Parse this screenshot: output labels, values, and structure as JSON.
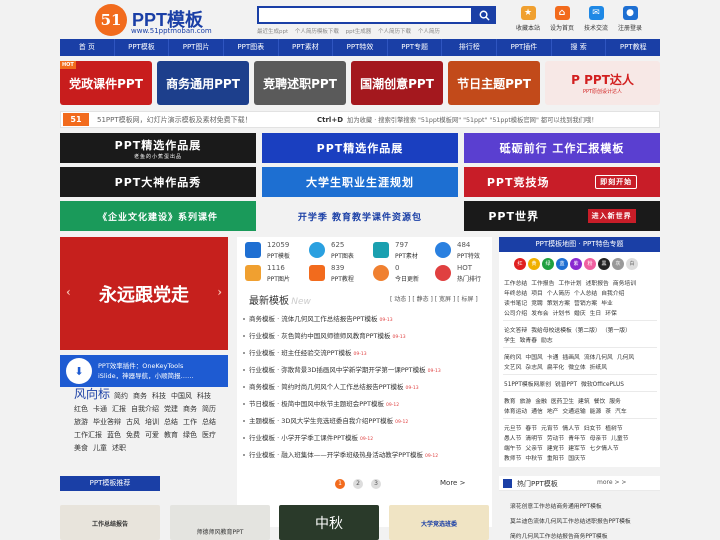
{
  "header": {
    "logo_mark": "51",
    "site_name": "PPT模板",
    "domain": "www.51pptmoban.com",
    "search_placeholder": "",
    "hot_links": [
      "最近生成ppt",
      "个人简历模板下载",
      "ppt生成器",
      "个人简历下载",
      "个人简历"
    ],
    "tools": [
      {
        "label": "收藏本站",
        "icon": "bookmark-icon",
        "color": "#f0a030"
      },
      {
        "label": "设为首页",
        "icon": "home-icon",
        "color": "#f26b1d"
      },
      {
        "label": "技术交流",
        "icon": "chat-icon",
        "color": "#1e88e5"
      },
      {
        "label": "注册登录",
        "icon": "user-icon",
        "color": "#1e6fd2"
      }
    ]
  },
  "nav": [
    "首 页",
    "PPT模板",
    "PPT图片",
    "PPT图表",
    "PPT素材",
    "PPT特效",
    "PPT专题",
    "排行榜",
    "PPT插件",
    "搜 索",
    "PPT教程"
  ],
  "categories": [
    {
      "label": "党政课件PPT",
      "color": "#c81d1d",
      "badge": "HOT"
    },
    {
      "label": "商务通用PPT",
      "color": "#1d3f8c"
    },
    {
      "label": "竞聘述职PPT",
      "color": "#5a5a5a"
    },
    {
      "label": "国潮创意PPT",
      "color": "#a4181e"
    },
    {
      "label": "节日主题PPT",
      "color": "#c24a1a"
    },
    {
      "label": "P PPT达人",
      "color": "#f7e8e6",
      "sub": "PPT原创设计达人"
    }
  ],
  "notice": {
    "badge": "51",
    "text": "51PPT模板网，幻灯片演示模板及素材免费下载！",
    "shortcut": "Ctrl+D",
    "tip": "加为收藏 · 搜索引擎搜索 \"51ppt模板网\" \"51ppt\" \"51ppt模板官网\" 都可以找到我们哦！"
  },
  "ads": [
    {
      "label": "PPT精选作品展",
      "sub": "老鱼的小蕉蛋出品",
      "color": "#1a1a1a"
    },
    {
      "label": "PPT精选作品展",
      "color": "#1a3fc0"
    },
    {
      "label": "砥砺前行 工作汇报模板",
      "color": "#5a3fd0"
    },
    {
      "label": "PPT大神作品秀",
      "color": "#1a1a1a"
    },
    {
      "label": "大学生职业生涯规划",
      "color": "#1d6fd2"
    },
    {
      "label": "PPT竞技场",
      "sub": "即刻开始",
      "color": "#c81d28"
    },
    {
      "label": "《企业文化建设》系列课件",
      "color": "#1a9a5a"
    },
    {
      "label": "开学季 教育教学课件资源包",
      "color": "#f2f2f2"
    },
    {
      "label": "PPT世界",
      "sub": "进入新世界",
      "color": "#1a1a1a"
    }
  ],
  "slider": {
    "text": "永远跟党走"
  },
  "tool_card": {
    "title": "PPT效率插件：OneKeyTools",
    "desc": "iSlide，神器导航，小顺简报……"
  },
  "tags": {
    "title": "风向标",
    "items": [
      "简约",
      "商务",
      "科技",
      "中国风",
      "科技",
      "红色",
      "卡通",
      "汇报",
      "自我介绍",
      "党建",
      "商务",
      "简历",
      "旅游",
      "毕业答辩",
      "古风",
      "培训",
      "总结",
      "工作",
      "总结",
      "工作汇报",
      "蓝色",
      "免费",
      "可爱",
      "教育",
      "绿色",
      "医疗",
      "美食",
      "儿童",
      "述职"
    ]
  },
  "stats": [
    {
      "num": "12059",
      "label": "PPT模板",
      "color": "#1e6fd2"
    },
    {
      "num": "625",
      "label": "PPT图表",
      "color": "#2aa0e0"
    },
    {
      "num": "797",
      "label": "PPT素材",
      "color": "#1aa0b0"
    },
    {
      "num": "484",
      "label": "PPT特效",
      "color": "#2a80e0"
    },
    {
      "num": "1116",
      "label": "PPT图片",
      "color": "#f0a030"
    },
    {
      "num": "839",
      "label": "PPT教程",
      "color": "#f26b1d"
    },
    {
      "num": "0",
      "label": "今日更新",
      "color": "#f08030"
    },
    {
      "num": "HOT",
      "label": "热门排行",
      "color": "#e04040"
    }
  ],
  "latest": {
    "title": "最新模板",
    "en": "New",
    "filters": "[ 动态 ] [ 静态 ] [ 宽屏 ] [ 标屏 ]",
    "items": [
      {
        "cat": "商务模板",
        "title": "流体几何风工作总结报告PPT模板",
        "date": "09-13"
      },
      {
        "cat": "行业模板",
        "title": "灰色简约中国风师德师风教育PPT模板",
        "date": "09-13"
      },
      {
        "cat": "行业模板",
        "title": "班主任经验交流PPT模板",
        "date": "09-13"
      },
      {
        "cat": "行业模板",
        "title": "弥散背景3D插画风中学新学期开学第一课PPT模板",
        "date": "09-13"
      },
      {
        "cat": "商务模板",
        "title": "简约时尚几何风个人工作总结报告PPT模板",
        "date": "09-13"
      },
      {
        "cat": "节日模板",
        "title": "极简中国风中秋节主题班会PPT模板",
        "date": "09-12"
      },
      {
        "cat": "主题模板",
        "title": "3D风大学生竞选班委自我介绍PPT模板",
        "date": "09-12"
      },
      {
        "cat": "行业模板",
        "title": "小学开学季工课件PPT模板",
        "date": "09-12"
      },
      {
        "cat": "行业模板",
        "title": "融入班集体——开学季班级热身活动教学PPT模板",
        "date": "09-12"
      }
    ]
  },
  "map": {
    "title": "PPT模板地图 · PPT特色专题",
    "colors": [
      {
        "label": "红",
        "color": "#e02020"
      },
      {
        "label": "黄",
        "color": "#f0b000"
      },
      {
        "label": "绿",
        "color": "#20a040"
      },
      {
        "label": "蓝",
        "color": "#1e6fd2"
      },
      {
        "label": "紫",
        "color": "#8a2ad0"
      },
      {
        "label": "粉",
        "color": "#f060a0"
      },
      {
        "label": "黑",
        "color": "#222222"
      },
      {
        "label": "灰",
        "color": "#999999"
      },
      {
        "label": "白",
        "color": "#dddddd"
      }
    ],
    "lines": [
      [
        "工作总结",
        "工作报告",
        "工作计划",
        "述职报告",
        "商务培训"
      ],
      [
        "年终总结",
        "项目",
        "个人简历",
        "个人总结",
        "自我介绍"
      ],
      [
        "读书笔记",
        "竞聘",
        "策划方案",
        "营销方案",
        "毕业"
      ],
      [
        "公司介绍",
        "发布会",
        "计划书",
        "婚庆",
        "生日",
        "环保"
      ],
      [
        "论文答辩",
        "我给母校送模板（第二版）",
        "（第一版）"
      ],
      [
        "学生",
        "致青春",
        "励志"
      ],
      [
        "简约风",
        "中国风",
        "卡通",
        "插画风",
        "流体几何风",
        "几何风"
      ],
      [
        "文艺风",
        "杂志风",
        "扁平化",
        "微立体",
        "折纸风"
      ],
      [
        "51PPT模板网原创",
        "锐普PPT",
        "微软OfficePLUS"
      ],
      [
        "教育",
        "旅游",
        "金融",
        "医药卫生",
        "建筑",
        "餐饮",
        "服务"
      ],
      [
        "体育运动",
        "通信",
        "地产",
        "交通运输",
        "能源",
        "茶",
        "汽车"
      ],
      [
        "元旦节",
        "春节",
        "元宵节",
        "情人节",
        "妇女节",
        "植树节"
      ],
      [
        "愚人节",
        "清明节",
        "劳动节",
        "青年节",
        "母亲节",
        "儿童节"
      ],
      [
        "端午节",
        "父亲节",
        "建党节",
        "建军节",
        "七夕情人节"
      ],
      [
        "教师节",
        "中秋节",
        "重阳节",
        "国庆节"
      ]
    ]
  },
  "bottom": {
    "rec_title": "PPT模板推荐",
    "pages": [
      "1",
      "2",
      "3"
    ],
    "more": "More >",
    "hot_title": "热门PPT模板",
    "hot_more": "more > >",
    "hot_items": [
      "滚花创意工作总结商务通用PPT模板",
      "莫兰迪色流体几何风工作总结述职报告PPT模板",
      "简约几何风工作总结报告商务PPT模板"
    ],
    "thumbs": [
      {
        "label": "工作总结报告",
        "color": "#e8e4dc"
      },
      {
        "label": "师德师风教育PPT",
        "color": "#e4e4e0"
      },
      {
        "label": "中秋",
        "color": "#2a3a2a"
      },
      {
        "label": "大学竞选班委",
        "color": "#f0e4c4"
      }
    ]
  }
}
